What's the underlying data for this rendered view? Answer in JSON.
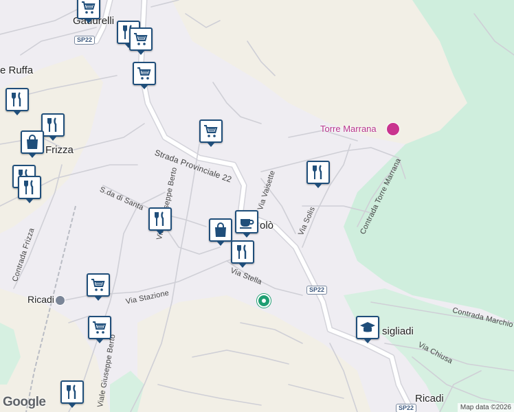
{
  "map": {
    "attribution": "Map data ©2026",
    "logo": "Google",
    "colors": {
      "land": "#efedf2",
      "hills": "#f2efe6",
      "green": "#cfeedd",
      "road": "#ffffff",
      "road_outline": "#d3d3da",
      "pin_border": "#1f4e7a",
      "poi_pink": "#b7348d",
      "park_marker": "#1f9e72"
    }
  },
  "labels": {
    "strada_provinciale": "Strada Provinciale 22",
    "viale_berto_north": "Viale Giuseppe Berto",
    "viale_berto_south": "Viale Giuseppe Berto",
    "via_stazione": "Via Stazione",
    "via_stella": "Via Stella",
    "via_vaisette": "Via Vaisette",
    "via_solis": "Via Solis",
    "contrada_torre": "Contrada Torre Marrana",
    "contrada_marchio": "Contrada Marchio",
    "contrada_frizza": "Contrada Frizza",
    "sda_santa": "S.da di Santa",
    "via_chiusa": "Via Chiusa",
    "place_ruffa": "e Ruffa",
    "place_frizza": "Frizza",
    "place_gauurelli": "Gauurelli",
    "place_olo": "olò",
    "place_ricadi_station": "Ricadi",
    "place_ricadi": "Ricadi",
    "place_sigliadi": "sigliadi",
    "poi_torre": "Torre Marrana",
    "shield_sp22": "SP22"
  },
  "markers": [
    {
      "icon": "shopping-cart-icon"
    },
    {
      "icon": "restaurant-icon"
    },
    {
      "icon": "shopping-cart-icon"
    },
    {
      "icon": "shopping-cart-icon"
    },
    {
      "icon": "restaurant-icon"
    },
    {
      "icon": "restaurant-icon"
    },
    {
      "icon": "shopping-bag-icon"
    },
    {
      "icon": "restaurant-icon"
    },
    {
      "icon": "restaurant-icon"
    },
    {
      "icon": "shopping-cart-icon"
    },
    {
      "icon": "restaurant-icon"
    },
    {
      "icon": "restaurant-icon"
    },
    {
      "icon": "shopping-bag-icon"
    },
    {
      "icon": "cafe-icon"
    },
    {
      "icon": "restaurant-icon"
    },
    {
      "icon": "shopping-cart-icon"
    },
    {
      "icon": "shopping-cart-icon"
    },
    {
      "icon": "restaurant-icon"
    },
    {
      "icon": "school-icon"
    }
  ]
}
